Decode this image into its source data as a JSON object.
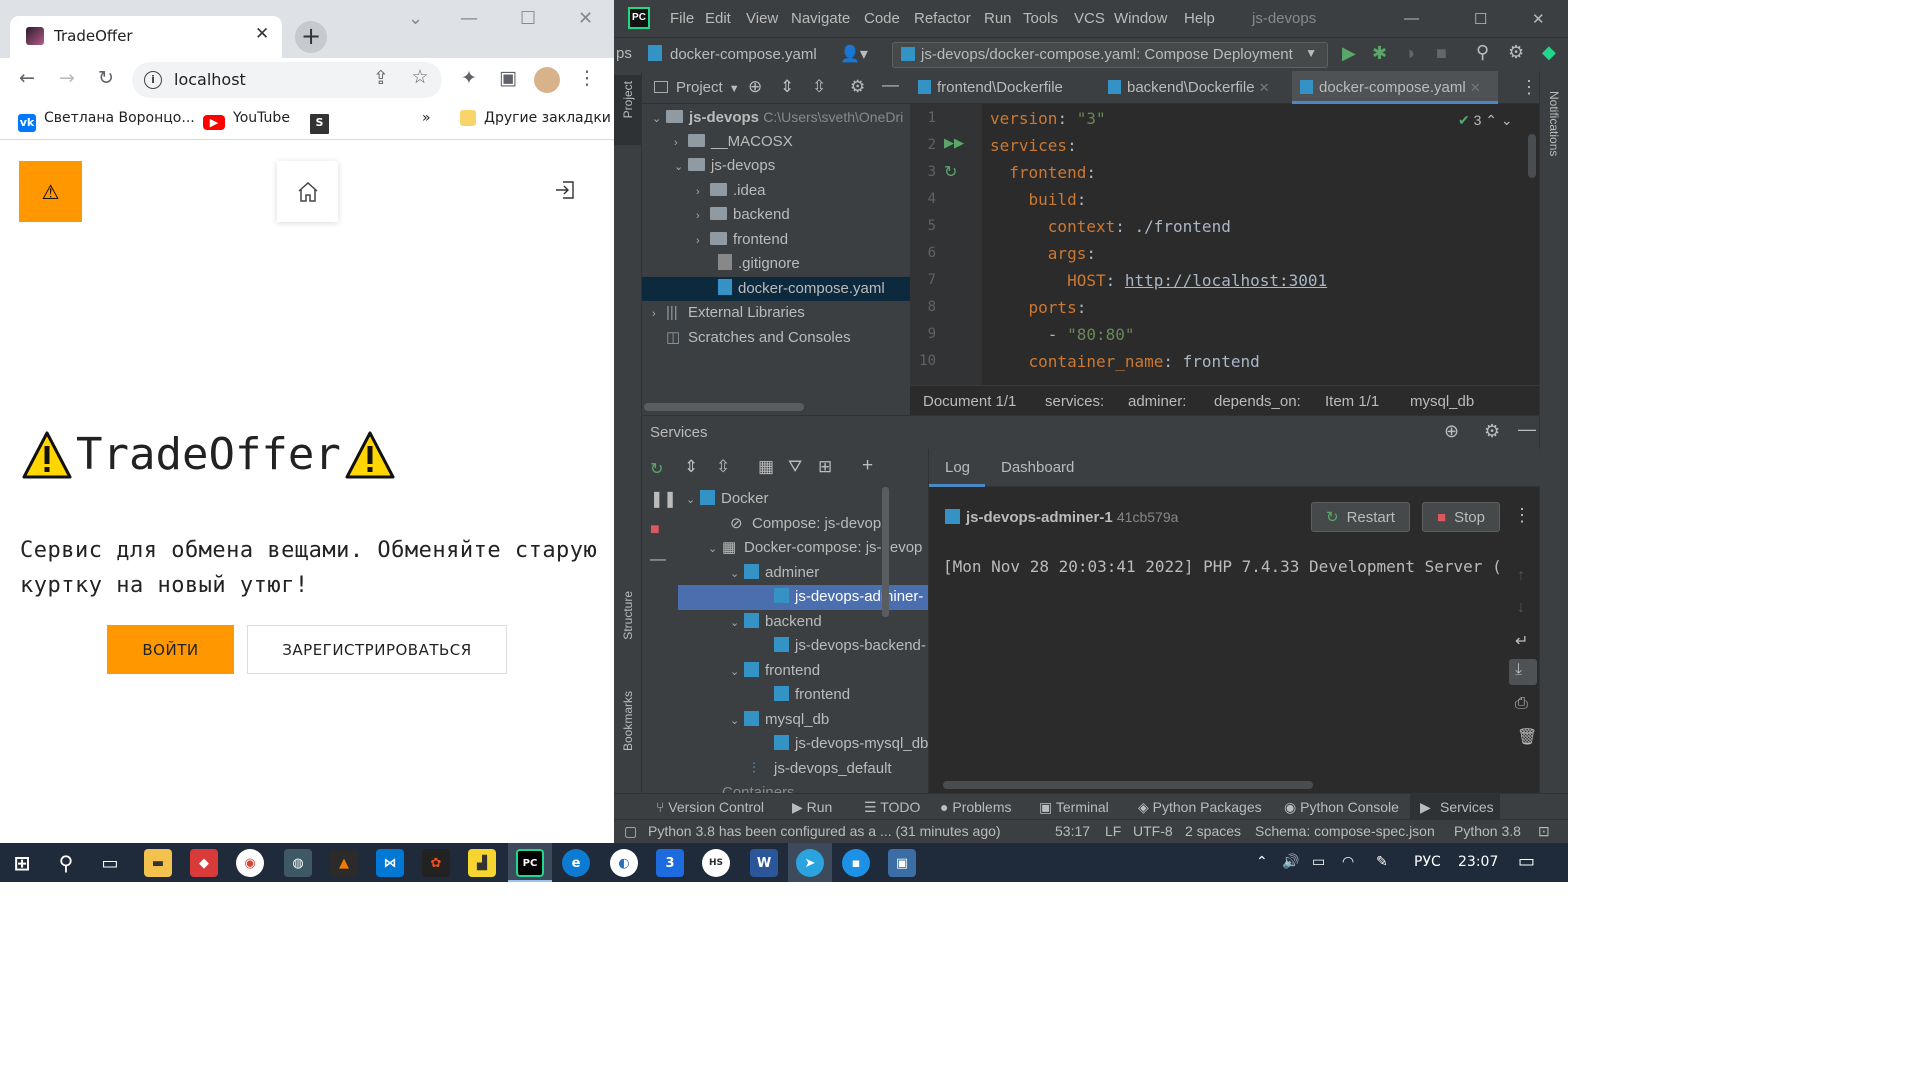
{
  "chrome": {
    "tab_title": "TradeOffer",
    "url": "localhost",
    "bookmarks": [
      {
        "label": "Светлана Воронцо...",
        "icon": "vk-icon"
      },
      {
        "label": "YouTube",
        "icon": "youtube-icon"
      },
      {
        "label": "",
        "icon": "s-icon"
      }
    ],
    "other_bookmarks": "Другие закладки",
    "bookmarks_overflow": "»"
  },
  "page": {
    "warning_glyph": "⚠",
    "title": "TradeOffer",
    "description": "Сервис для обмена вещами. Обменяйте старую куртку на новый утюг!",
    "login_button": "ВОЙТИ",
    "register_button": "ЗАРЕГИСТРИРОВАТЬСЯ"
  },
  "ide": {
    "menu": [
      "File",
      "Edit",
      "View",
      "Navigate",
      "Code",
      "Refactor",
      "Run",
      "Tools",
      "VCS",
      "Window",
      "Help"
    ],
    "project_name": "js-devops",
    "nav_file": "docker-compose.yaml",
    "nav_prefix": "ps",
    "run_config": "js-devops/docker-compose.yaml: Compose Deployment",
    "project_panel_title": "Project",
    "project_tree": [
      {
        "label": "js-devops",
        "extra": "C:\\Users\\sveth\\OneDri"
      },
      {
        "label": "__MACOSX"
      },
      {
        "label": "js-devops"
      },
      {
        "label": ".idea"
      },
      {
        "label": "backend"
      },
      {
        "label": "frontend"
      },
      {
        "label": ".gitignore"
      },
      {
        "label": "docker-compose.yaml"
      },
      {
        "label": "External Libraries"
      },
      {
        "label": "Scratches and Consoles"
      }
    ],
    "editor_tabs": [
      "frontend\\Dockerfile",
      "backend\\Dockerfile",
      "docker-compose.yaml"
    ],
    "inspection_count": "3",
    "code_lines": [
      "1",
      "2",
      "3",
      "4",
      "5",
      "6",
      "7",
      "8",
      "9",
      "10"
    ],
    "code": {
      "l1k": "version",
      "l1v": "\"3\"",
      "l2k": "services",
      "l3k": "frontend",
      "l4k": "build",
      "l5k": "context",
      "l5v": "./frontend",
      "l6k": "args",
      "l7k": "HOST",
      "l7v": "http://localhost:3001",
      "l8k": "ports",
      "l9v": "\"80:80\"",
      "l10k": "container_name",
      "l10v": "frontend"
    },
    "breadcrumbs": [
      "Document 1/1",
      "services:",
      "adminer:",
      "depends_on:",
      "Item 1/1",
      "mysql_db"
    ],
    "left_strip": {
      "project": "Project",
      "structure": "Structure",
      "bookmarks": "Bookmarks"
    },
    "right_strip": {
      "notifications": "Notifications"
    },
    "services_title": "Services",
    "services_tree": [
      {
        "label": "Docker"
      },
      {
        "label": "Compose: js-devops"
      },
      {
        "label": "Docker-compose: js-devop"
      },
      {
        "label": "adminer"
      },
      {
        "label": "js-devops-adminer-"
      },
      {
        "label": "backend"
      },
      {
        "label": "js-devops-backend-"
      },
      {
        "label": "frontend"
      },
      {
        "label": "frontend"
      },
      {
        "label": "mysql_db"
      },
      {
        "label": "js-devops-mysql_db"
      },
      {
        "label": "js-devops_default"
      },
      {
        "label": "Containers"
      }
    ],
    "log_tabs": [
      "Log",
      "Dashboard"
    ],
    "container_name": "js-devops-adminer-1",
    "container_id": "41cb579a",
    "restart_button": "Restart",
    "stop_button": "Stop",
    "log_line": "[Mon Nov 28 20:03:41 2022] PHP 7.4.33 Development Server (",
    "tool_windows": [
      "Version Control",
      "Run",
      "TODO",
      "Problems",
      "Terminal",
      "Python Packages",
      "Python Console",
      "Services"
    ],
    "status": {
      "message": "Python 3.8 has been configured as a ... (31 minutes ago)",
      "position": "53:17",
      "line_sep": "LF",
      "encoding": "UTF-8",
      "indent": "2 spaces",
      "schema": "Schema: compose-spec.json",
      "interpreter": "Python 3.8"
    }
  },
  "taskbar": {
    "language": "РУС",
    "time": "23:07"
  }
}
